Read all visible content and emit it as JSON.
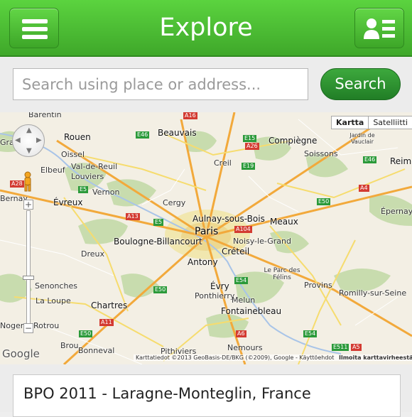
{
  "header": {
    "title": "Explore",
    "menu_icon": "hamburger-menu-icon",
    "profile_icon": "user-card-icon",
    "color": "#4cc33a"
  },
  "search": {
    "placeholder": "Search using place or address...",
    "button_label": "Search",
    "button_color": "#2a8c2e"
  },
  "map": {
    "map_type": {
      "selected": "Kartta",
      "other": "Satelliitti"
    },
    "labels": {
      "barentin": "Barentin",
      "rouen": "Rouen",
      "oissel": "Oissel",
      "val_de_reuil": "Val-de-Reuil",
      "elbeuf": "Elbeuf",
      "louviers": "Louviers",
      "vernon": "Vernon",
      "bernay": "Bernay",
      "evreux": "Évreux",
      "beauvais": "Beauvais",
      "compiegne": "Compiègne",
      "soissons": "Soissons",
      "creil": "Creil",
      "cergy": "Cergy",
      "aulnay": "Aulnay-sous-Bois",
      "paris": "Paris",
      "meaux": "Meaux",
      "boulogne": "Boulogne-Billancourt",
      "noisy": "Noisy-le-Grand",
      "creteil": "Créteil",
      "antony": "Antony",
      "dreux": "Dreux",
      "evry": "Évry",
      "pontherry": "Ponthierry",
      "melun": "Melun",
      "parc_felins": "Le Parc des Félins",
      "provins": "Provins",
      "romilly": "Romilly-sur-Seine",
      "epernay": "Épernay",
      "reims": "Reim",
      "vauclair": "Jardin de Vauclair",
      "senonches": "Senonches",
      "chartres": "Chartres",
      "la_loupe": "La Loupe",
      "nogent": "Nogent",
      "rotrou": "Rotrou",
      "fontainebleau": "Fontainebleau",
      "brou": "Brou",
      "bonneval": "Bonneval",
      "nemours": "Nemours",
      "pithiviers": "Pithiviers",
      "gra": "Gra"
    },
    "roads": {
      "a16": "A16",
      "e46": "E46",
      "e15": "E15",
      "a26": "A26",
      "e19": "E19",
      "e5": "E5",
      "a28": "A28",
      "a13": "A13",
      "a104": "A104",
      "e50": "E50",
      "e54": "E54",
      "a4": "A4",
      "a11": "A11",
      "a6": "A6",
      "e511": "E511",
      "a5": "A5"
    },
    "attribution": "Karttatiedot ©2013 GeoBasis-DE/BKG (©2009), Google - Käyttöehdot",
    "report": "Ilmoita karttavirheestä",
    "logo": "Google",
    "controls": {
      "zoom_in": "+",
      "zoom_out": "−"
    }
  },
  "results": {
    "items": [
      {
        "title": "BPO 2011 - Laragne-Monteglin, France"
      }
    ]
  }
}
